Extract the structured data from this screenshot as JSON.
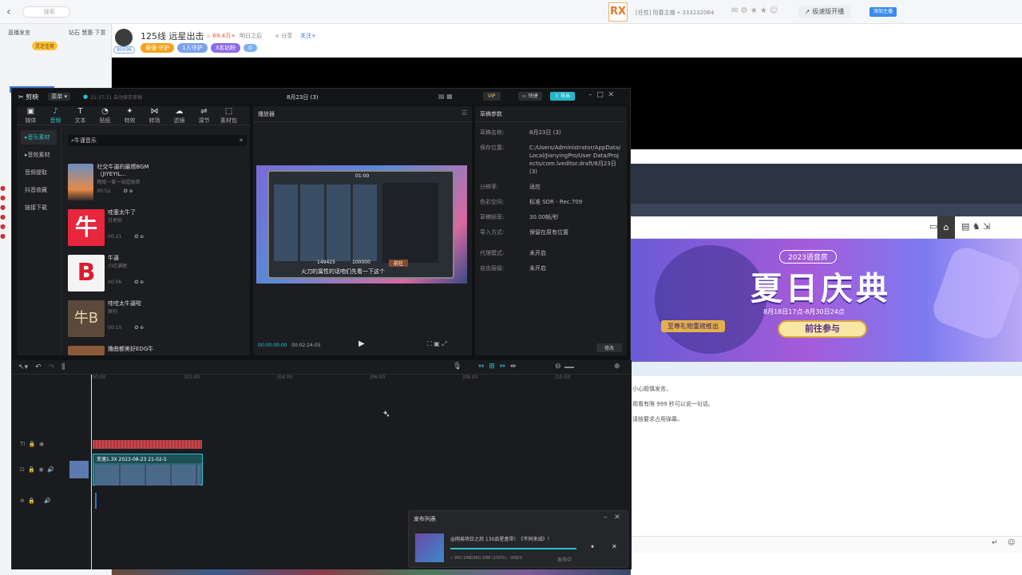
{
  "top": {
    "back_glyph": "‹",
    "search_placeholder": "搜索",
    "room_title": "[任性] 阳春主播 • 333232064",
    "upgrade": "极速版开播",
    "small_btn": "添加主播"
  },
  "stream": {
    "title": "125线 远星出击",
    "heat": "69.4万+",
    "game": "明日之后",
    "share": "分享",
    "follow": "关注+",
    "id_badge": "90096",
    "tags": [
      "最强·守护",
      "1人守护",
      "3名钻粉",
      "0"
    ]
  },
  "left": {
    "rows": [
      "直播发言",
      "钻石 慧惠·下意"
    ],
    "gift": "灵芝佳荷"
  },
  "banner": {
    "year": "2023语音房",
    "title": "夏日庆典",
    "dates": "8月18日17点-8月30日24点",
    "cta": "前往参与",
    "note": "至尊礼物重磅推出"
  },
  "chat": {
    "lines": [
      "小心题慎发言。",
      "观看有限 999 秒可以说一句话。",
      "请按要求占用弹幕。"
    ]
  },
  "capcut": {
    "app_name": "剪映",
    "menu": "菜单",
    "autosave": "21:37:31 自动保存草稿",
    "project": "8月23日 (3)",
    "vip": "VIP",
    "shortcut": "快捷",
    "export": "导出",
    "tools": [
      {
        "icon": "▣",
        "label": "媒体"
      },
      {
        "icon": "♪",
        "label": "音频"
      },
      {
        "icon": "T",
        "label": "文本"
      },
      {
        "icon": "◔",
        "label": "贴纸"
      },
      {
        "icon": "✦",
        "label": "特效"
      },
      {
        "icon": "⋈",
        "label": "转场"
      },
      {
        "icon": "☁",
        "label": "滤镜"
      },
      {
        "icon": "⇌",
        "label": "调节"
      },
      {
        "icon": "⬚",
        "label": "素材包"
      }
    ],
    "side": [
      "音乐素材",
      "音效素材",
      "音频提取",
      "抖音收藏",
      "链接下载"
    ],
    "search_value": "牛谨音乐",
    "audio": [
      {
        "title": "社交牛逼的最燃BGM（JIYEYIL...",
        "sub": "网络一套一站超级燃",
        "dur": "00:52",
        "thumb_color": "#e38a4a",
        "thumb_text": ""
      },
      {
        "title": "哇塞太牛了",
        "sub": "甘地伯",
        "dur": "00:21",
        "thumb_color": "#e8263c",
        "thumb_text": "牛"
      },
      {
        "title": "牛逼",
        "sub": "小红满额",
        "dur": "00:06",
        "thumb_color": "#f4f4f4",
        "thumb_text": "B"
      },
      {
        "title": "哇哇太牛逼啦",
        "sub": "原创",
        "dur": "00:10",
        "thumb_color": "#5b4a3a",
        "thumb_text": "牛B"
      },
      {
        "title": "撸曲都美好EDG牛",
        "sub": "",
        "dur": "",
        "thumb_color": "#8a5a3a",
        "thumb_text": ""
      }
    ],
    "player": {
      "title": "播放器",
      "time_current": "00:00:00:00",
      "time_total": "00:02:24:05",
      "subtitle": "火刀的属性的话咱们先看一下这个",
      "game_clock": "01:00",
      "money1": "149425",
      "money2": "100000",
      "btn": "前往"
    },
    "props": {
      "title": "草稿参数",
      "rows": [
        {
          "k": "草稿名称:",
          "v": "8月23日 (3)"
        },
        {
          "k": "保存位置:",
          "v": "C:/Users/Administrator/AppData/Local/JianyingPro/User Data/Projects/com.lveditor.draft/8月23日 (3)"
        },
        {
          "k": "分辨率:",
          "v": "适应"
        },
        {
          "k": "色彩空间:",
          "v": "标准 SDR - Rec.709"
        },
        {
          "k": "草稿帧率:",
          "v": "30.00帧/秒"
        },
        {
          "k": "导入方式:",
          "v": "保留在原有位置"
        },
        {
          "k": "代理模式:",
          "v": "未开启"
        },
        {
          "k": "自由层级:",
          "v": "未开启"
        }
      ],
      "modify": "修改"
    },
    "ruler": [
      "00:00",
      "|02:00",
      "|04:00",
      "|06:00",
      "|08:00",
      "|10:00"
    ],
    "clip_label": "变速1.3X  2023-08-23 21-02-5",
    "publish": {
      "title": "发布列表",
      "item": "@网易明日之后 130品星盒带！《不同来战》！",
      "progress": "960.1MB/960.1MB (100%) · 0KB/S",
      "status": "发布中"
    }
  }
}
